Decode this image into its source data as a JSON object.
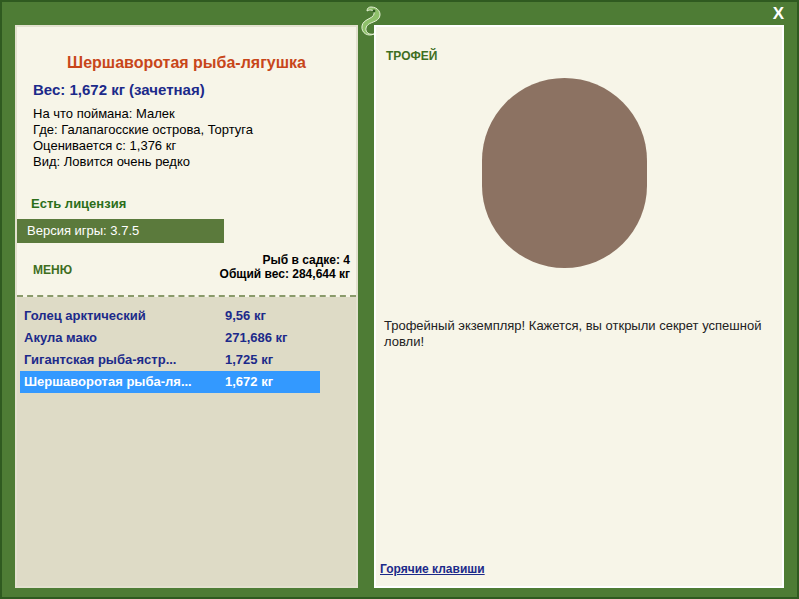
{
  "close": "X",
  "fish": {
    "title": "Шершаворотая рыба-лягушка",
    "weight": "Вес: 1,672 кг (зачетная)",
    "info": [
      "На что поймана: Малек",
      "Где: Галапагосские острова, Тортуга",
      "Оценивается с: 1,376 кг",
      "Вид: Ловится очень редко"
    ],
    "license": "Есть лицензия",
    "version": "Версия игры: 3.7.5"
  },
  "menu": {
    "label": "МЕНЮ"
  },
  "keepnet": {
    "count": "Рыб в садке: 4",
    "total": "Общий вес: 284,644 кг",
    "items": [
      {
        "name": "Голец арктический",
        "weight": "9,56 кг",
        "selected": false
      },
      {
        "name": "Акула мако",
        "weight": "271,686 кг",
        "selected": false
      },
      {
        "name": "Гигантская рыба-ястр...",
        "weight": "1,725 кг",
        "selected": false
      },
      {
        "name": "Шершаворотая рыба-ля...",
        "weight": "1,672 кг",
        "selected": true
      }
    ]
  },
  "trophy": {
    "label": "ТРОФЕЙ",
    "message": "Трофейный экземпляр! Кажется, вы открыли секрет успешной ловли!",
    "hotkeys": "Горячие клавиши"
  }
}
